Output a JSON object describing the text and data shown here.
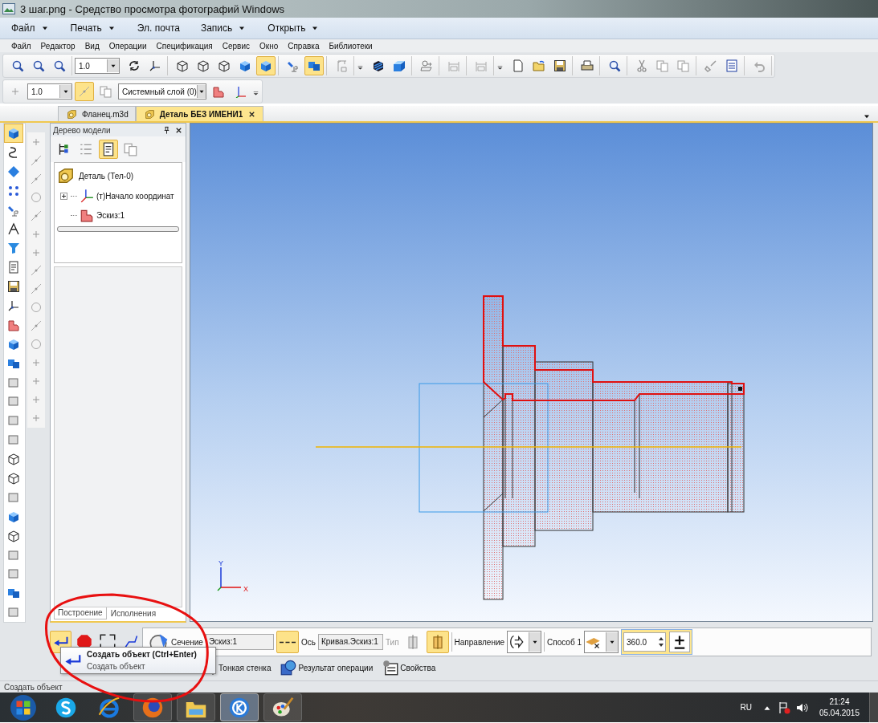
{
  "window": {
    "title": "3 шаг.png - Средство просмотра фотографий Windows"
  },
  "viewer_menu": [
    {
      "label": "Файл",
      "dropdown": true
    },
    {
      "label": "Печать",
      "dropdown": true
    },
    {
      "label": "Эл. почта",
      "dropdown": false
    },
    {
      "label": "Запись",
      "dropdown": true
    },
    {
      "label": "Открыть",
      "dropdown": true
    }
  ],
  "menu": [
    "Файл",
    "Редактор",
    "Вид",
    "Операции",
    "Спецификация",
    "Сервис",
    "Окно",
    "Справка",
    "Библиотеки"
  ],
  "toolbar_main": {
    "scale": "1.0",
    "buttons": [
      {
        "selected": false
      },
      {
        "selected": false
      },
      {
        "selected": false
      },
      {
        "selected": false
      },
      {
        "selected": false
      },
      {
        "selected": false
      },
      {
        "selected": false
      },
      {
        "selected": false
      },
      {
        "selected": false
      },
      {
        "selected": true
      },
      {
        "selected": false
      },
      {
        "selected": true
      },
      {
        "selected": false
      },
      {
        "selected": false
      },
      {
        "selected": false
      },
      {
        "selected": false
      },
      {
        "selected": false
      },
      {
        "selected": false
      },
      {
        "selected": false
      },
      {
        "selected": false
      },
      {
        "selected": false
      },
      {
        "selected": false
      },
      {
        "selected": false
      },
      {
        "selected": false
      },
      {
        "selected": false
      },
      {
        "selected": false
      },
      {
        "selected": false
      },
      {
        "selected": false
      },
      {
        "selected": false
      }
    ]
  },
  "toolbar_current": {
    "step": "1.0",
    "layer": "Системный слой (0)",
    "buttons": [
      {
        "selected": false
      },
      {
        "selected": true
      },
      {
        "selected": false
      },
      {
        "selected": false
      },
      {
        "selected": false
      }
    ]
  },
  "document_tabs": [
    {
      "label": "Фланец.m3d",
      "selected": false
    },
    {
      "label": "Деталь БЕЗ ИМЕНИ1",
      "selected": true
    }
  ],
  "left_toolbar": [
    {
      "selected": true
    },
    {
      "selected": false
    },
    {
      "selected": false
    },
    {
      "selected": false
    },
    {
      "selected": false
    },
    {
      "selected": false
    },
    {
      "selected": false
    },
    {
      "selected": false
    },
    {
      "selected": false
    },
    {
      "selected": false
    },
    {
      "selected": false
    },
    {
      "selected": false
    },
    {
      "selected": false
    },
    {
      "selected": false
    },
    {
      "selected": false
    },
    {
      "selected": false
    },
    {
      "selected": false
    },
    {
      "selected": false
    },
    {
      "selected": false
    },
    {
      "selected": false
    },
    {
      "selected": false
    },
    {
      "selected": false
    },
    {
      "selected": false
    },
    {
      "selected": false
    },
    {
      "selected": false
    },
    {
      "selected": false
    }
  ],
  "tree_panel": {
    "title": "Дерево модели",
    "toolbar": [
      {
        "selected": false
      },
      {
        "selected": false
      },
      {
        "selected": true
      },
      {
        "selected": false
      }
    ],
    "tree": [
      {
        "label": "Деталь (Тел-0)",
        "children": [
          {
            "label": "(т)Начало координат",
            "expanded": false
          },
          {
            "label": "Эскиз:1"
          }
        ]
      }
    ],
    "tabs": [
      {
        "label": "Построение",
        "selected": true
      },
      {
        "label": "Исполнения",
        "selected": false
      }
    ]
  },
  "viewport": {
    "axis_labels": [
      "Y",
      "X"
    ]
  },
  "property_bar": {
    "buttons": [
      {
        "selected": true
      },
      {
        "selected": false
      },
      {
        "selected": false
      },
      {
        "selected": false
      }
    ],
    "section_label": "Сечение",
    "section_value": "Эскиз:1",
    "axis_button_selected": true,
    "axis_label": "Ось",
    "axis_value": "Кривая.Эскиз:1",
    "type_label": "Тип",
    "type_disabled": true,
    "type_buttons": [
      {
        "selected": false
      },
      {
        "selected": true
      }
    ],
    "direction_label": "Направление",
    "method_label": "Способ 1",
    "angle": "360.0",
    "tabs": [
      {
        "label": "Тонкая стенка"
      },
      {
        "label": "Результат операции"
      },
      {
        "label": "Свойства"
      }
    ]
  },
  "tooltip": {
    "title": "Создать объект (Ctrl+Enter)",
    "text": "Создать объект"
  },
  "status_bar": {
    "text": "Создать объект"
  },
  "taskbar": {
    "apps": [
      {
        "selected": false
      },
      {
        "selected": false
      },
      {
        "selected": false
      },
      {
        "selected": false
      },
      {
        "selected": true
      },
      {
        "selected": false
      }
    ],
    "language": "RU",
    "time": "21:24",
    "date": "05.04.2015"
  }
}
